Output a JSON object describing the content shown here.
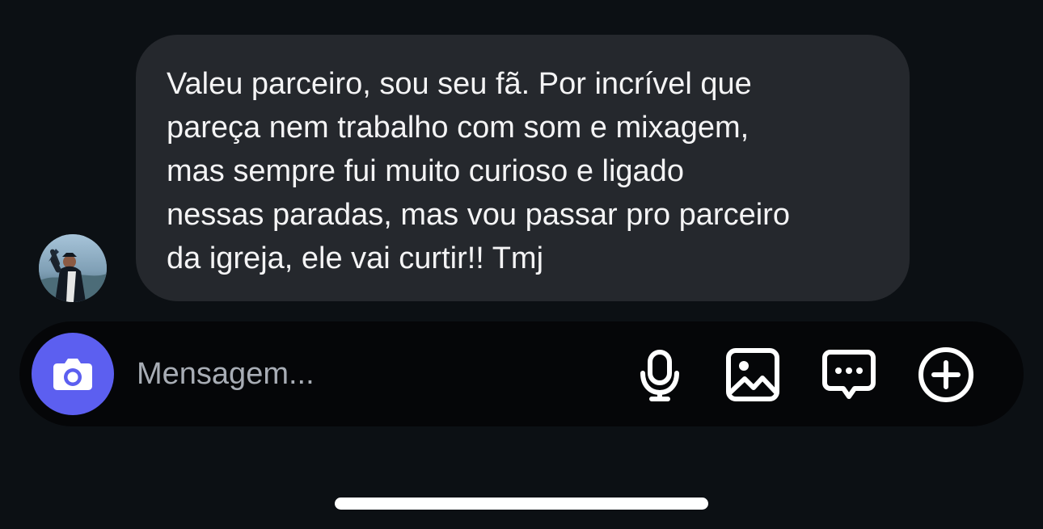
{
  "message": {
    "lines": [
      "Valeu parceiro, sou seu fã. Por incrível que",
      "pareça nem trabalho com som e mixagem,",
      "mas sempre fui muito curioso e ligado",
      "nessas paradas, mas vou passar pro parceiro",
      "da igreja, ele vai curtir!! Tmj"
    ]
  },
  "composer": {
    "placeholder": "Mensagem...",
    "accent_color": "#5c5ff0"
  },
  "icons": {
    "camera": "camera-icon",
    "microphone": "microphone-icon",
    "gallery": "image-icon",
    "chat": "chat-bubble-icon",
    "add": "plus-circle-icon"
  }
}
